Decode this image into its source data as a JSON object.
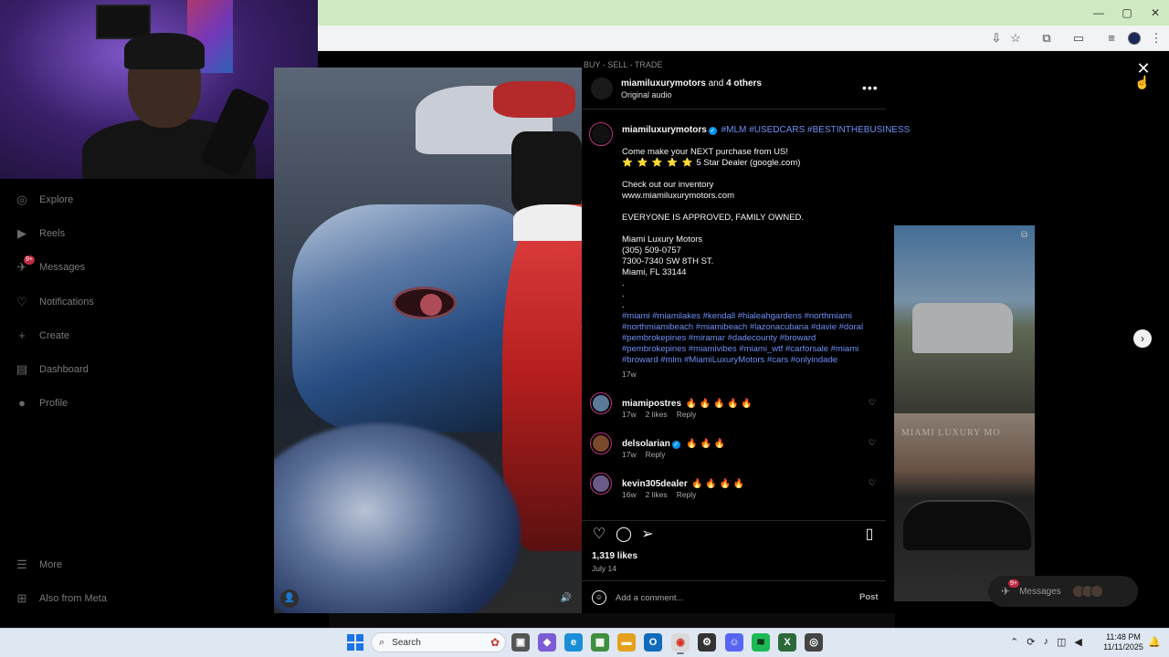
{
  "browser": {
    "window_controls": {
      "minimize": "—",
      "maximize": "▢",
      "close": "✕"
    }
  },
  "background_page": {
    "banner_text": "BUY - SELL - TRADE",
    "thumb_sign_text": "MIAMI LUXURY MO"
  },
  "nav": {
    "items": [
      {
        "label": "Explore",
        "icon": "compass-icon",
        "glyph": "◎"
      },
      {
        "label": "Reels",
        "icon": "reels-icon",
        "glyph": "▶"
      },
      {
        "label": "Messages",
        "icon": "messages-icon",
        "glyph": "✈",
        "badge": "9+"
      },
      {
        "label": "Notifications",
        "icon": "heart-icon",
        "glyph": "♡"
      },
      {
        "label": "Create",
        "icon": "plus-icon",
        "glyph": "+"
      },
      {
        "label": "Dashboard",
        "icon": "dashboard-icon",
        "glyph": "▤"
      },
      {
        "label": "Profile",
        "icon": "profile-icon",
        "glyph": "●"
      }
    ],
    "more": "More",
    "meta": "Also from Meta"
  },
  "post": {
    "header": {
      "user": "miamiluxurymotors",
      "and_text": "and",
      "others": "4 others",
      "audio": "Original audio"
    },
    "caption": {
      "user": "miamiluxurymotors",
      "header_tags": "#MLM #USEDCARS #BESTINTHEBUSINESS",
      "line1": "Come make your NEXT purchase from US!",
      "stars": "⭐ ⭐ ⭐ ⭐ ⭐",
      "dealer": "5 Star Dealer (google.com)",
      "line3": "Check out our inventory",
      "line4": "www.miamiluxurymotors.com",
      "line5": "EVERYONE IS APPROVED, FAMILY OWNED.",
      "line6": "Miami Luxury Motors",
      "line7": "(305) 509-0757",
      "line8": "7300-7340 SW 8TH ST.",
      "line9": "Miami, FL 33144",
      "dot": ".",
      "tags": "#miami #miamilakes #kendall #hialeahgardens #northmiami #northmiamibeach #miamibeach #lazonacubana #davie #doral #pembrokepines #miramar #dadecounty #broward #pembrokepines #miamivibes #miami_wtf #carforsale #miami #broward #mlm #MiamiLuxuryMotors #cars #onlyindade",
      "time": "17w"
    },
    "comments": [
      {
        "user": "miamipostres",
        "text": "🔥 🔥 🔥 🔥 🔥",
        "time": "17w",
        "likes": "2 likes",
        "reply": "Reply",
        "verified": false
      },
      {
        "user": "delsolarian",
        "text": "🔥 🔥 🔥",
        "time": "17w",
        "likes": "",
        "reply": "Reply",
        "verified": true
      },
      {
        "user": "kevin305dealer",
        "text": "🔥 🔥 🔥 🔥",
        "time": "16w",
        "likes": "2 likes",
        "reply": "Reply",
        "verified": false
      }
    ],
    "likes": "1,319 likes",
    "date": "July 14",
    "comment_placeholder": "Add a comment...",
    "post_label": "Post"
  },
  "messages_pill": {
    "label": "Messages",
    "badge": "9+"
  },
  "taskbar": {
    "search_placeholder": "Search",
    "time": "11:48 PM",
    "date": "11/11/2025"
  },
  "colors": {
    "accent": "#6f8ff5",
    "verified": "#0095f6",
    "taskbar": "#dfe7f2"
  }
}
